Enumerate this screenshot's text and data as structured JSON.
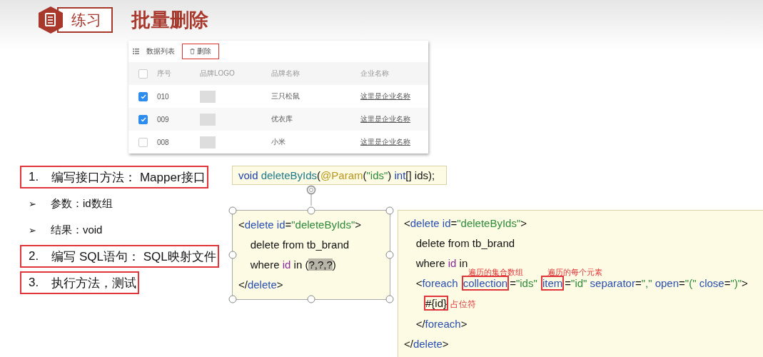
{
  "header": {
    "badge": "练习",
    "title": "批量删除"
  },
  "table_card": {
    "toolbar": {
      "list_label": "数据列表",
      "delete_button": "删除"
    },
    "columns": [
      {
        "kind": "check",
        "checked": false
      },
      {
        "label": "序号",
        "kind": "text"
      },
      {
        "label": "品牌LOGO",
        "kind": "text"
      },
      {
        "label": "品牌名称",
        "kind": "text"
      },
      {
        "label": "企业名称",
        "kind": "text"
      }
    ],
    "rows": [
      {
        "checked": true,
        "number": "010",
        "brand": "三只松鼠",
        "company": "这里是企业名称"
      },
      {
        "checked": true,
        "number": "009",
        "brand": "优衣库",
        "company": "这里是企业名称"
      },
      {
        "checked": false,
        "number": "008",
        "brand": "小米",
        "company": "这里是企业名称"
      }
    ]
  },
  "steps": [
    {
      "kind": "step",
      "marker": "1.",
      "text": "编写接口方法： Mapper接口"
    },
    {
      "kind": "bullet",
      "marker": "➢",
      "text": "参数：id数组"
    },
    {
      "kind": "bullet",
      "marker": "➢",
      "text": "结果：void"
    },
    {
      "kind": "step",
      "marker": "2.",
      "text": "编写 SQL语句： SQL映射文件"
    },
    {
      "kind": "step",
      "marker": "3.",
      "text": "执行方法，测试"
    }
  ],
  "signature": [
    {
      "text": "void ",
      "kind": "keyword"
    },
    {
      "text": "deleteByIds",
      "kind": "method"
    },
    {
      "text": "(",
      "kind": "punct"
    },
    {
      "text": "@Param",
      "kind": "annotation"
    },
    {
      "text": "(",
      "kind": "punct"
    },
    {
      "text": "\"ids\"",
      "kind": "string"
    },
    {
      "text": ") ",
      "kind": "punct"
    },
    {
      "text": "int",
      "kind": "keyword"
    },
    {
      "text": "[] ids);",
      "kind": "punct"
    }
  ],
  "code_blocks": [
    {
      "selected": true,
      "lines": [
        [
          {
            "text": "<",
            "kind": "punct"
          },
          {
            "text": "delete id",
            "kind": "tag"
          },
          {
            "text": "=",
            "kind": "punct"
          },
          {
            "text": "\"deleteByIds\"",
            "kind": "string"
          },
          {
            "text": ">",
            "kind": "punct"
          }
        ],
        [
          {
            "text": "    delete from tb_brand",
            "kind": "punct"
          }
        ],
        [
          {
            "text": "    where ",
            "kind": "punct"
          },
          {
            "text": "id",
            "kind": "var"
          },
          {
            "text": " in (",
            "kind": "punct"
          },
          {
            "text": "?,?,?",
            "kind": "punct",
            "highlight": true
          },
          {
            "text": ")",
            "kind": "punct"
          }
        ],
        [
          {
            "text": "</",
            "kind": "punct"
          },
          {
            "text": "delete",
            "kind": "tag"
          },
          {
            "text": ">",
            "kind": "punct"
          }
        ]
      ]
    },
    {
      "selected": false,
      "lines": [
        [
          {
            "text": "<",
            "kind": "punct"
          },
          {
            "text": "delete id",
            "kind": "tag"
          },
          {
            "text": "=",
            "kind": "punct"
          },
          {
            "text": "\"deleteByIds\"",
            "kind": "string"
          },
          {
            "text": ">",
            "kind": "punct"
          }
        ],
        [
          {
            "text": "    delete from tb_brand",
            "kind": "punct"
          }
        ],
        [
          {
            "text": "    where ",
            "kind": "punct"
          },
          {
            "text": "id",
            "kind": "var"
          },
          {
            "text": " in",
            "kind": "punct"
          }
        ],
        [
          {
            "text": "    <",
            "kind": "punct"
          },
          {
            "text": "foreach ",
            "kind": "tag"
          },
          {
            "text": "collection",
            "kind": "tag",
            "boxed": true,
            "note": "遍历的集合数组"
          },
          {
            "text": "=",
            "kind": "punct"
          },
          {
            "text": "\"ids\" ",
            "kind": "string"
          },
          {
            "text": "item",
            "kind": "tag",
            "boxed": true,
            "note": "遍历的每个元素"
          },
          {
            "text": "=",
            "kind": "punct"
          },
          {
            "text": "\"id\" ",
            "kind": "string"
          },
          {
            "text": "separator",
            "kind": "tag"
          },
          {
            "text": "=",
            "kind": "punct"
          },
          {
            "text": "\",\" ",
            "kind": "string"
          },
          {
            "text": "open",
            "kind": "tag"
          },
          {
            "text": "=",
            "kind": "punct"
          },
          {
            "text": "\"(\" ",
            "kind": "string"
          },
          {
            "text": "close",
            "kind": "tag"
          },
          {
            "text": "=",
            "kind": "punct"
          },
          {
            "text": "\")\"",
            "kind": "string"
          },
          {
            "text": ">",
            "kind": "punct"
          }
        ],
        [
          {
            "text": "#{id}",
            "kind": "punct",
            "boxed": true
          },
          {
            "text": "占位符",
            "kind": "note"
          }
        ],
        [
          {
            "text": "    </",
            "kind": "punct"
          },
          {
            "text": "foreach",
            "kind": "tag"
          },
          {
            "text": ">",
            "kind": "punct"
          }
        ],
        [
          {
            "text": "</",
            "kind": "punct"
          },
          {
            "text": "delete",
            "kind": "tag"
          },
          {
            "text": ">",
            "kind": "punct"
          }
        ]
      ]
    }
  ]
}
